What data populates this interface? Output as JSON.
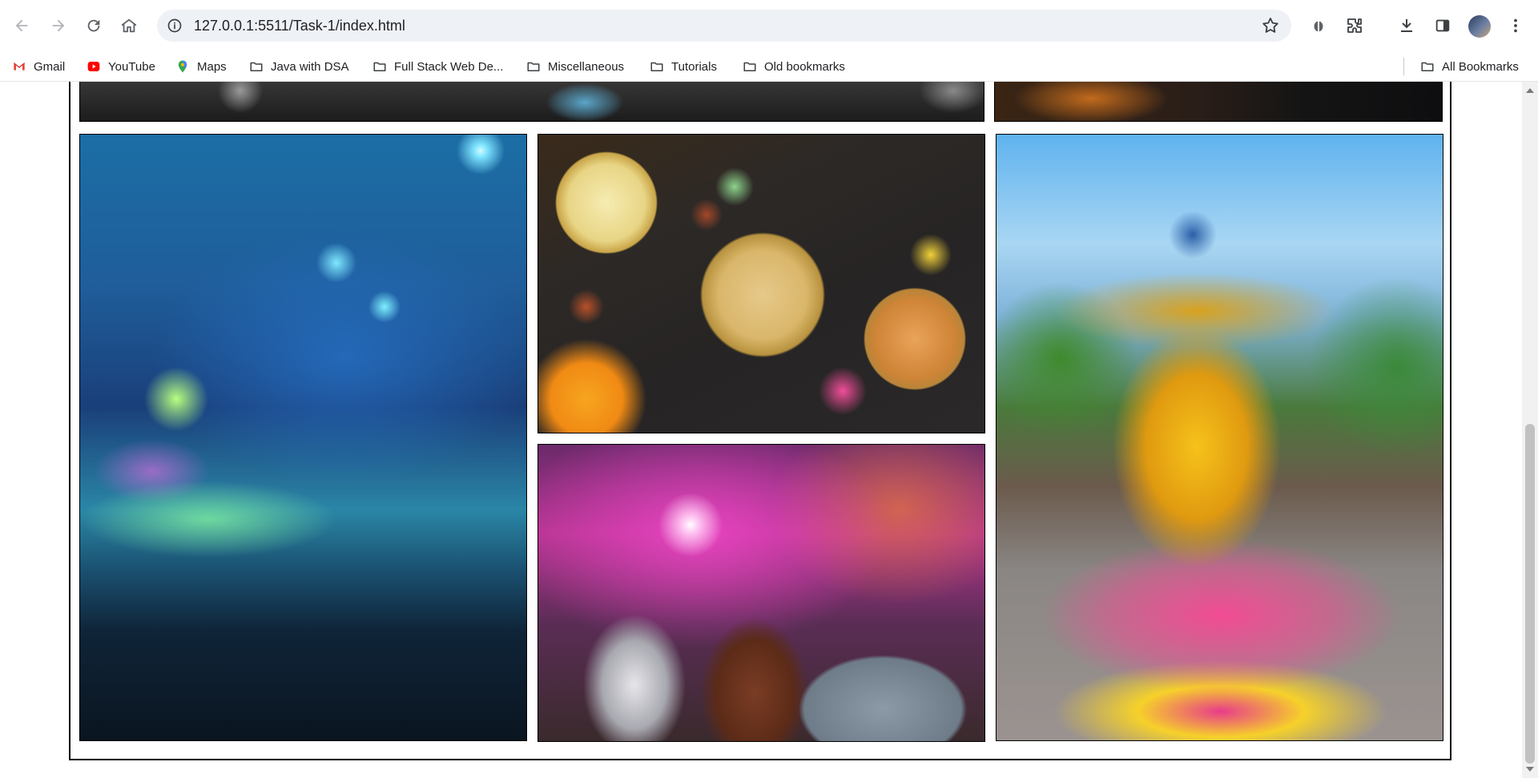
{
  "browser": {
    "url": "127.0.0.1:5511/Task-1/index.html",
    "icons": [
      "back-icon",
      "forward-icon",
      "reload-icon",
      "home-icon",
      "info-icon",
      "star-icon",
      "extension-bug-icon",
      "extensions-icon",
      "download-icon",
      "side-panel-icon",
      "avatar",
      "menu-icon"
    ]
  },
  "bookmarks": {
    "items": [
      {
        "label": "Gmail",
        "icon": "gmail-icon"
      },
      {
        "label": "YouTube",
        "icon": "youtube-icon"
      },
      {
        "label": "Maps",
        "icon": "maps-icon"
      },
      {
        "label": "Java with DSA",
        "icon": "folder-icon"
      },
      {
        "label": "Full Stack Web De...",
        "icon": "folder-icon"
      },
      {
        "label": "Miscellaneous",
        "icon": "folder-icon"
      },
      {
        "label": "Tutorials",
        "icon": "folder-icon"
      },
      {
        "label": "Old bookmarks",
        "icon": "folder-icon"
      }
    ],
    "all_bookmarks": "All Bookmarks"
  },
  "gallery": {
    "tiles": [
      {
        "name": "concert-backstage-photo",
        "subject": "concert equipment, black and white"
      },
      {
        "name": "city-night-photo",
        "subject": "city street at night"
      },
      {
        "name": "concert-lights-photo",
        "subject": "concert crowd with blue lights and confetti"
      },
      {
        "name": "diwali-sweets-photo",
        "subject": "diwali sweets and diyas"
      },
      {
        "name": "kathakali-dancer-photo",
        "subject": "kathakali dancer with flower petals"
      },
      {
        "name": "music-festival-crowd-photo",
        "subject": "festival crowd cheering"
      }
    ]
  }
}
